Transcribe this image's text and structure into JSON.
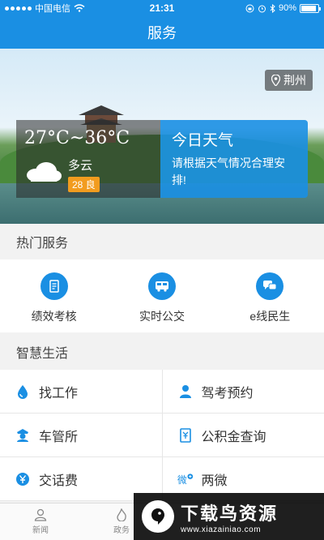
{
  "status": {
    "carrier": "中国电信",
    "time": "21:31",
    "battery": "90%",
    "battery_level": 0.9
  },
  "nav": {
    "title": "服务"
  },
  "banner": {
    "location": "荆州",
    "temperature": "27°C~36°C",
    "condition": "多云",
    "aqi": "28 良",
    "today_title": "今日天气",
    "advice": "请根据天气情况合理安排!"
  },
  "hot": {
    "title": "热门服务",
    "items": [
      {
        "label": "绩效考核",
        "icon": "document-icon"
      },
      {
        "label": "实时公交",
        "icon": "bus-icon"
      },
      {
        "label": "e线民生",
        "icon": "chat-icon"
      }
    ]
  },
  "life": {
    "title": "智慧生活",
    "items": [
      {
        "label": "找工作",
        "icon": "drop-icon"
      },
      {
        "label": "驾考预约",
        "icon": "person-icon"
      },
      {
        "label": "车管所",
        "icon": "police-icon"
      },
      {
        "label": "公积金查询",
        "icon": "fund-icon"
      },
      {
        "label": "交话费",
        "icon": "yen-icon"
      },
      {
        "label": "两微",
        "icon": "weibo-icon"
      }
    ]
  },
  "tabs": [
    {
      "label": "新闻",
      "icon": "person-icon"
    },
    {
      "label": "政务",
      "icon": "flame-icon"
    }
  ],
  "watermark": {
    "title": "下载鸟资源",
    "url": "www.xiazainiao.com"
  },
  "colors": {
    "accent": "#1a8fe3",
    "aqi": "#f29c1f"
  }
}
